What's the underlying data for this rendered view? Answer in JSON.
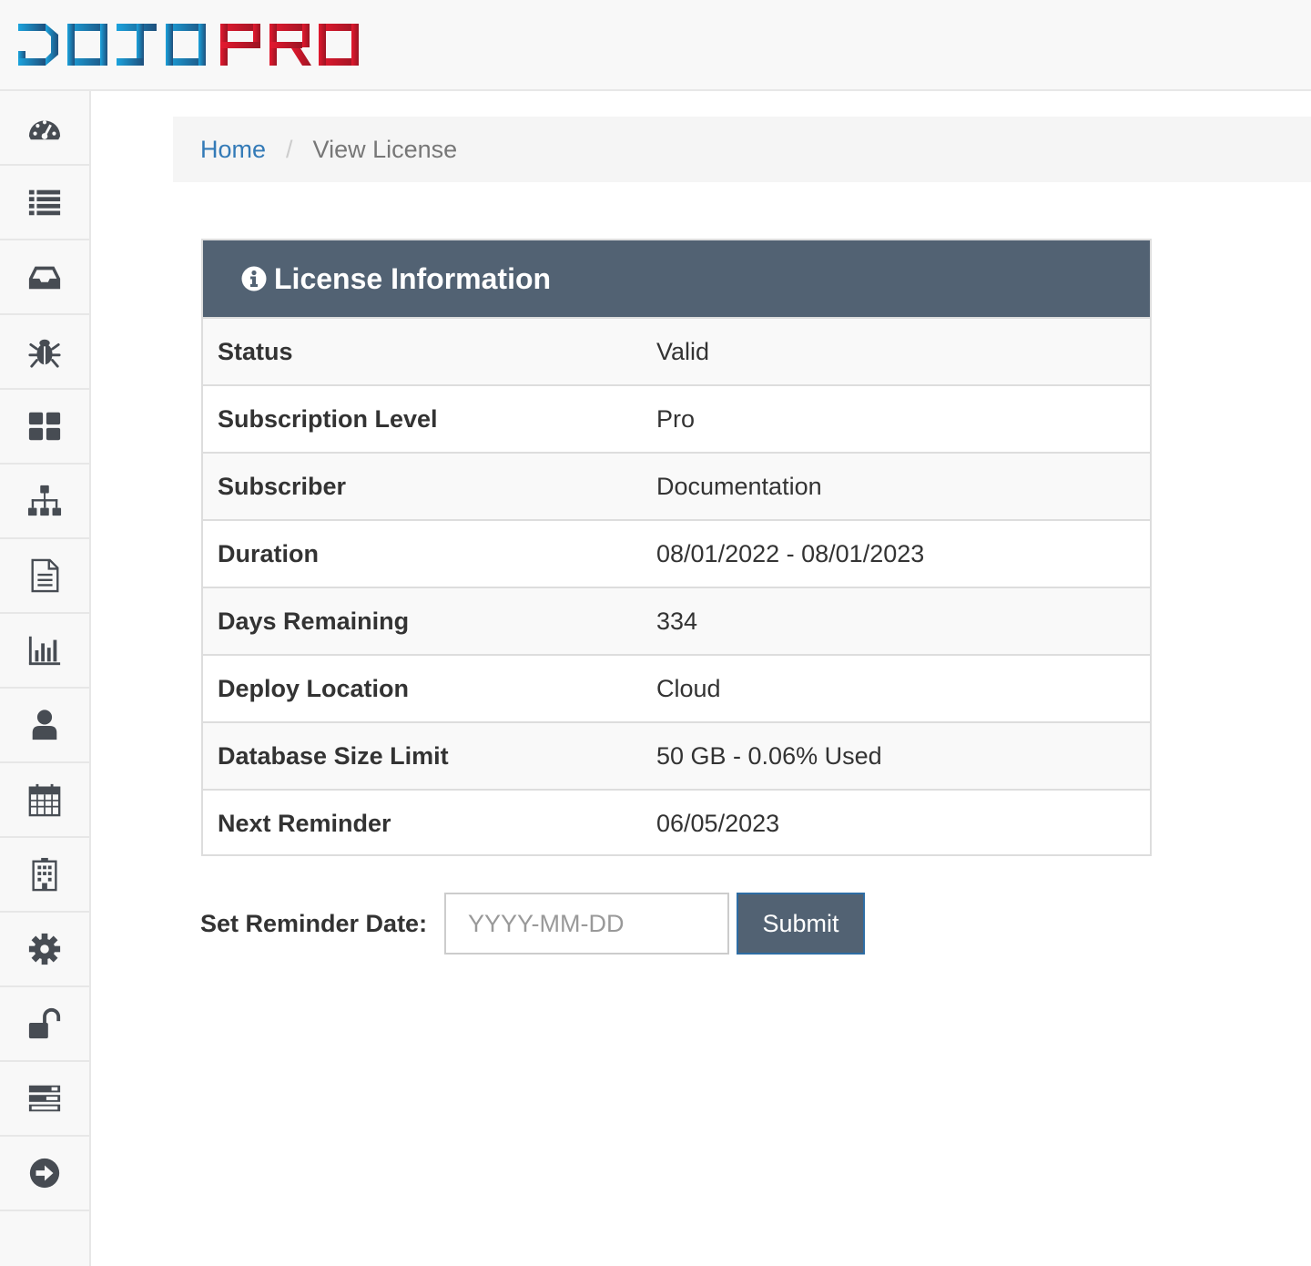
{
  "header": {
    "logo_text": "DOJO PRO",
    "logo_colors": {
      "dojo": "#1a9ad6",
      "pro": "#e0182d"
    }
  },
  "sidebar": {
    "items": [
      {
        "icon": "dashboard-icon"
      },
      {
        "icon": "list-icon"
      },
      {
        "icon": "inbox-icon"
      },
      {
        "icon": "bug-icon"
      },
      {
        "icon": "th-large-icon"
      },
      {
        "icon": "sitemap-icon"
      },
      {
        "icon": "file-text-icon"
      },
      {
        "icon": "bar-chart-icon"
      },
      {
        "icon": "user-icon"
      },
      {
        "icon": "calendar-icon"
      },
      {
        "icon": "building-icon"
      },
      {
        "icon": "gear-icon"
      },
      {
        "icon": "unlock-icon"
      },
      {
        "icon": "tasks-icon"
      },
      {
        "icon": "arrow-circle-right-icon"
      }
    ]
  },
  "breadcrumb": {
    "home": "Home",
    "separator": "/",
    "current": "View License"
  },
  "license": {
    "title": "License Information",
    "rows": [
      {
        "label": "Status",
        "value": "Valid"
      },
      {
        "label": "Subscription Level",
        "value": "Pro"
      },
      {
        "label": "Subscriber",
        "value": "Documentation"
      },
      {
        "label": "Duration",
        "value": "08/01/2022 - 08/01/2023"
      },
      {
        "label": "Days Remaining",
        "value": "334"
      },
      {
        "label": "Deploy Location",
        "value": "Cloud"
      },
      {
        "label": "Database Size Limit",
        "value": "50 GB - 0.06% Used"
      },
      {
        "label": "Next Reminder",
        "value": "06/05/2023"
      }
    ]
  },
  "reminder_form": {
    "label": "Set Reminder Date:",
    "placeholder": "YYYY-MM-DD",
    "value": "",
    "submit_label": "Submit"
  },
  "colors": {
    "panel_heading": "#526273",
    "link": "#337ab7",
    "icon": "#474c53"
  }
}
